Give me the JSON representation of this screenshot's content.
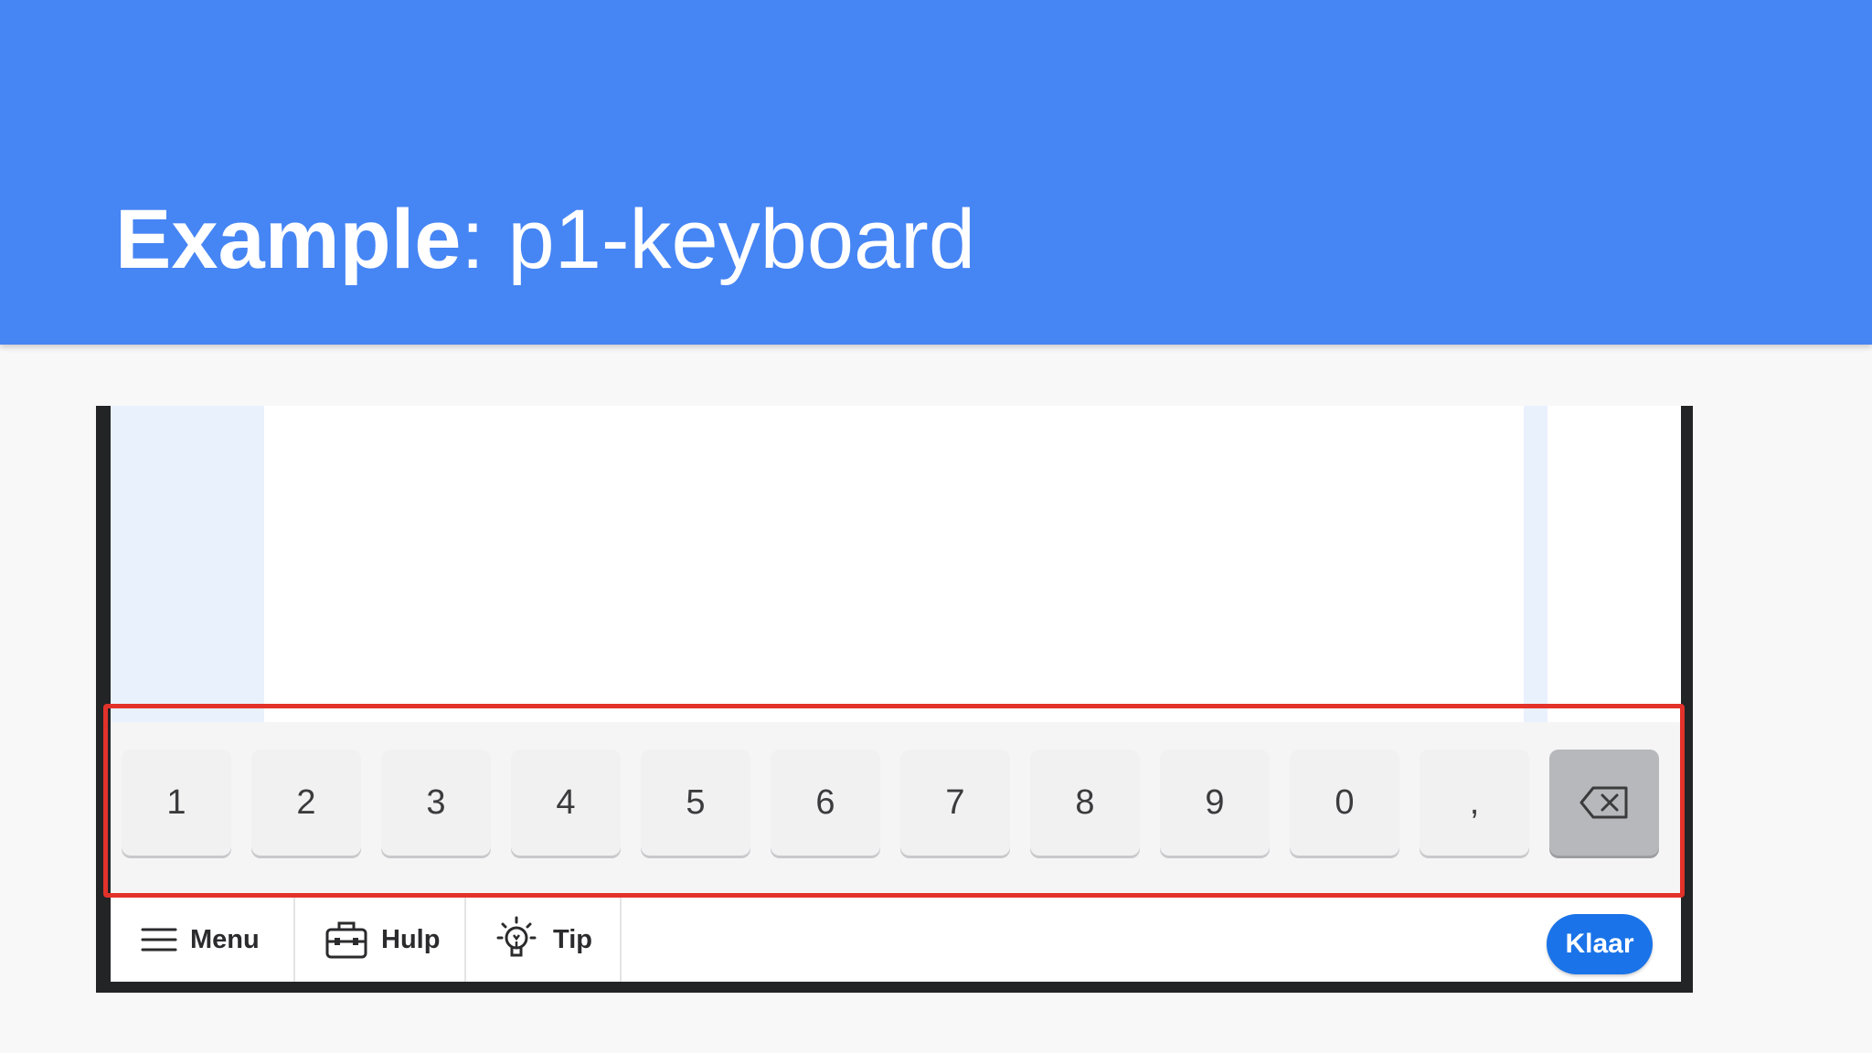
{
  "slide": {
    "title_bold": "Example",
    "title_rest": ": p1-keyboard",
    "header_color": "#4685f4"
  },
  "keyboard": {
    "keys": [
      "1",
      "2",
      "3",
      "4",
      "5",
      "6",
      "7",
      "8",
      "9",
      "0",
      ","
    ],
    "backspace_icon": "backspace-icon"
  },
  "toolbar": {
    "menu_label": "Menu",
    "menu_icon": "hamburger-menu-icon",
    "help_label": "Hulp",
    "help_icon": "toolbox-icon",
    "tip_label": "Tip",
    "tip_icon": "lightbulb-icon",
    "done_label": "Klaar",
    "done_color": "#1a73e8"
  },
  "annotation": {
    "highlight_color": "#e3322a"
  }
}
